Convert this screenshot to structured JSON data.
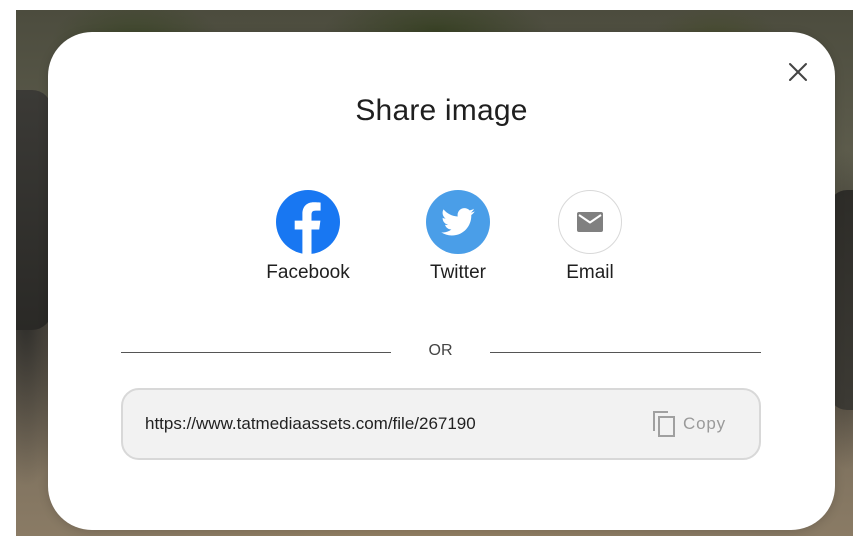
{
  "dialog": {
    "title": "Share image",
    "close_icon": "close-icon"
  },
  "share_options": [
    {
      "label": "Facebook",
      "icon": "facebook-icon",
      "color": "#1877f2"
    },
    {
      "label": "Twitter",
      "icon": "twitter-icon",
      "color": "#4a9ee8"
    },
    {
      "label": "Email",
      "icon": "email-icon",
      "color": "#808080"
    }
  ],
  "divider": {
    "label": "OR"
  },
  "link": {
    "url": "https://www.tatmediaassets.com/file/267190",
    "copy_label": "Copy",
    "copy_icon": "copy-icon"
  }
}
